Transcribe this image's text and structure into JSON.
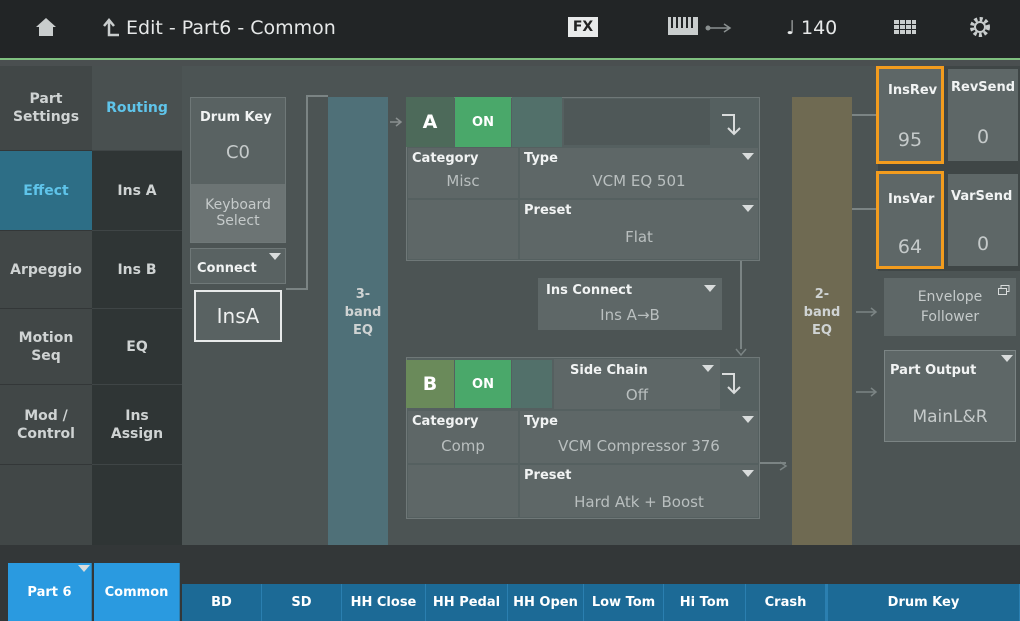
{
  "header": {
    "title": "Edit - Part6 - Common",
    "fx_label": "FX",
    "tempo": "♩ 140"
  },
  "left_tabs": [
    {
      "label": "Part Settings"
    },
    {
      "label": "Effect"
    },
    {
      "label": "Arpeggio"
    },
    {
      "label": "Motion Seq"
    },
    {
      "label": "Mod / Control"
    }
  ],
  "sub_tabs": [
    {
      "label": "Routing"
    },
    {
      "label": "Ins A"
    },
    {
      "label": "Ins B"
    },
    {
      "label": "EQ"
    },
    {
      "label": "Ins Assign"
    }
  ],
  "drum_key": {
    "label": "Drum Key",
    "value": "C0",
    "keyboard_select": "Keyboard Select"
  },
  "connect": {
    "label": "Connect",
    "value": "InsA"
  },
  "eq3": {
    "label": "3-band EQ"
  },
  "eq2": {
    "label": "2-band EQ"
  },
  "ins_a": {
    "letter": "A",
    "on": "ON",
    "category_label": "Category",
    "category": "Misc",
    "type_label": "Type",
    "type": "VCM EQ 501",
    "preset_label": "Preset",
    "preset": "Flat"
  },
  "ins_connect": {
    "label": "Ins Connect",
    "value": "Ins A→B"
  },
  "ins_b": {
    "letter": "B",
    "on": "ON",
    "side_chain_label": "Side Chain",
    "side_chain": "Off",
    "category_label": "Category",
    "category": "Comp",
    "type_label": "Type",
    "type": "VCM Compressor 376",
    "preset_label": "Preset",
    "preset": "Hard Atk + Boost"
  },
  "sends": {
    "insrev_label": "InsRev",
    "insrev": "95",
    "revsend_label": "RevSend",
    "revsend": "0",
    "insvar_label": "InsVar",
    "insvar": "64",
    "varsend_label": "VarSend",
    "varsend": "0"
  },
  "envelope": {
    "label": "Envelope Follower"
  },
  "part_output": {
    "label": "Part Output",
    "value": "MainL&R"
  },
  "bottom_tabs": [
    "Part 6",
    "Common",
    "BD",
    "SD",
    "HH Close",
    "HH Pedal",
    "HH Open",
    "Low Tom",
    "Hi Tom",
    "Crash",
    "Drum Key"
  ],
  "colors": {
    "accent": "#2a9ae0",
    "highlight": "#f39c1e",
    "on": "#4aa86a"
  }
}
